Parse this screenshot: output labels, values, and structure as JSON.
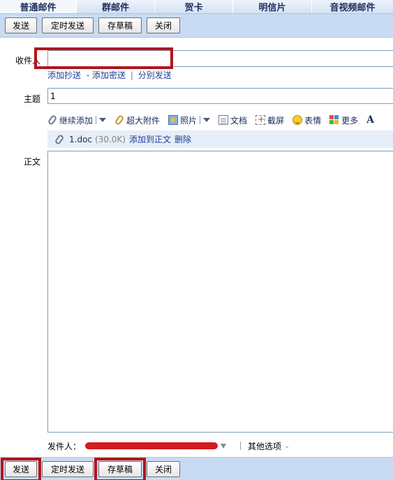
{
  "tabs": [
    {
      "label": "普通邮件",
      "active": true
    },
    {
      "label": "群邮件",
      "active": false
    },
    {
      "label": "贺卡",
      "active": false
    },
    {
      "label": "明信片",
      "active": false
    },
    {
      "label": "音视频邮件",
      "active": false
    }
  ],
  "toolbar": {
    "send": "发送",
    "timed_send": "定时发送",
    "save_draft": "存草稿",
    "close": "关闭"
  },
  "form": {
    "recipient_label": "收件人",
    "recipient_value": "",
    "links": {
      "add_cc": "添加抄送",
      "add_bcc": "- 添加密送",
      "separator": "|",
      "separate_send": "分别发送"
    },
    "subject_label": "主题",
    "subject_value": "1",
    "body_label": "正文"
  },
  "attach_tools": {
    "continue_add": "继续添加",
    "large_attach": "超大附件",
    "photo": "照片",
    "document": "文档",
    "screenshot": "截屏",
    "emoji": "表情",
    "more": "更多"
  },
  "attachment": {
    "filename": "1.doc",
    "size": "(30.0K)",
    "add_to_body": "添加到正文",
    "delete": "删除"
  },
  "sender": {
    "label": "发件人：",
    "other_options": "其他选项"
  },
  "colors": {
    "toolbar_bg": "#c9dbf3",
    "highlight_red": "#b3141c",
    "link_blue": "#1c3f94"
  }
}
